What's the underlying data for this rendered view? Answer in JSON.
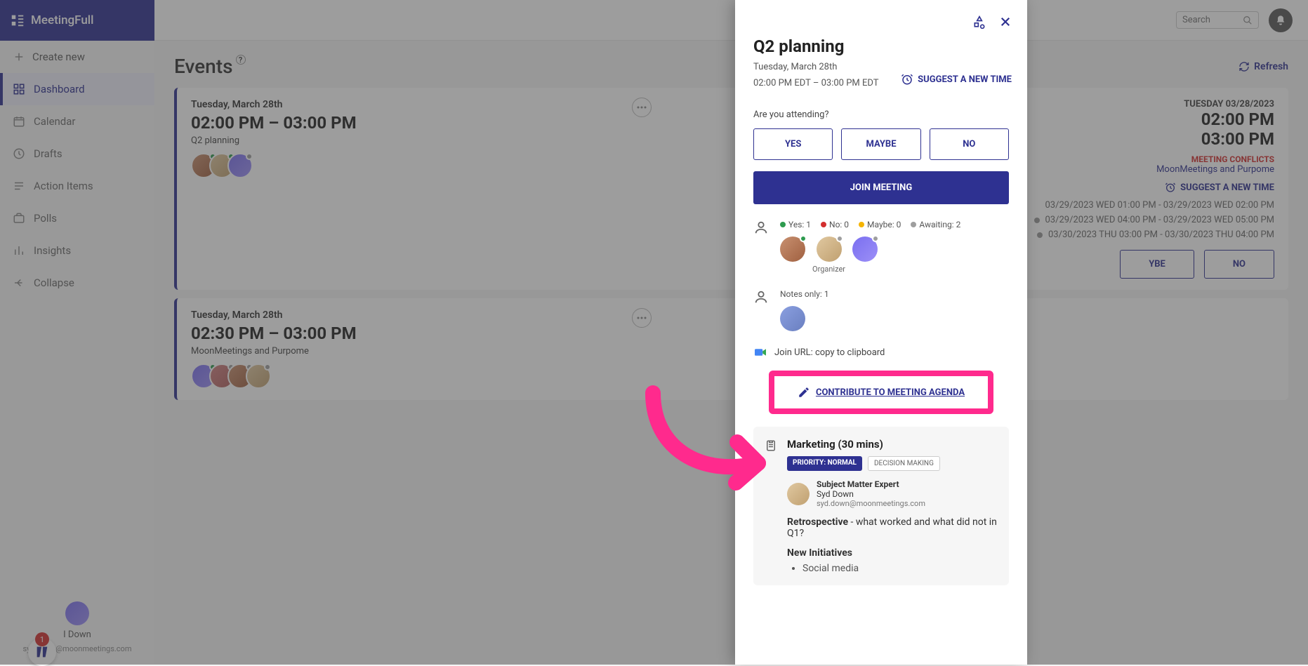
{
  "brand": "MeetingFull",
  "sidebar": {
    "createNew": "Create new",
    "items": [
      {
        "label": "Dashboard"
      },
      {
        "label": "Calendar"
      },
      {
        "label": "Drafts"
      },
      {
        "label": "Action Items"
      },
      {
        "label": "Polls"
      },
      {
        "label": "Insights"
      },
      {
        "label": "Collapse"
      }
    ],
    "userName": "I Down",
    "userEmail": "syd.down@moonmeetings.com",
    "badge": "1"
  },
  "topbar": {
    "searchPlaceholder": "Search"
  },
  "page": {
    "title": "Events",
    "refresh": "Refresh"
  },
  "events": [
    {
      "date": "Tuesday, March 28th",
      "time": "02:00 PM – 03:00 PM",
      "title": "Q2 planning",
      "right": {
        "date": "TUESDAY 03/28/2023",
        "start": "02:00 PM",
        "end": "03:00 PM",
        "conflictsLabel": "MEETING CONFLICTS",
        "conflictsWith": "MoonMeetings and Purpome",
        "suggest": "SUGGEST A NEW TIME",
        "slots": [
          "03/29/2023 WED 01:00 PM - 03/29/2023 WED 02:00 PM",
          "03/29/2023 WED 04:00 PM - 03/29/2023 WED 05:00 PM",
          "03/30/2023 THU 03:00 PM - 03/30/2023 THU 04:00 PM"
        ],
        "rsvp": {
          "maybe": "YBE",
          "no": "NO"
        }
      }
    },
    {
      "date": "Tuesday, March 28th",
      "time": "02:30 PM – 03:00 PM",
      "title": "MoonMeetings and Purpome"
    }
  ],
  "panel": {
    "title": "Q2 planning",
    "dateLine": "Tuesday, March 28th",
    "timeLine": "02:00 PM EDT – 03:00 PM EDT",
    "suggest": "SUGGEST A NEW TIME",
    "attendQ": "Are you attending?",
    "rsvp": {
      "yes": "YES",
      "maybe": "MAYBE",
      "no": "NO"
    },
    "join": "JOIN MEETING",
    "counts": {
      "yes": "Yes: 1",
      "no": "No: 0",
      "maybe": "Maybe: 0",
      "awaiting": "Awaiting: 2"
    },
    "organizer": "Organizer",
    "notesOnly": "Notes only: 1",
    "joinUrl": "Join URL: copy to clipboard",
    "contribute": "CONTRIBUTE TO MEETING AGENDA",
    "agenda": {
      "title": "Marketing (30 mins)",
      "priority": "PRIORITY: NORMAL",
      "tag": "DECISION MAKING",
      "sme": {
        "role": "Subject Matter Expert",
        "name": "Syd Down",
        "email": "syd.down@moonmeetings.com"
      },
      "retroLabel": "Retrospective",
      "retroText": " - what worked and what did not in Q1?",
      "newInit": "New Initiatives",
      "bullet": "Social media"
    }
  }
}
